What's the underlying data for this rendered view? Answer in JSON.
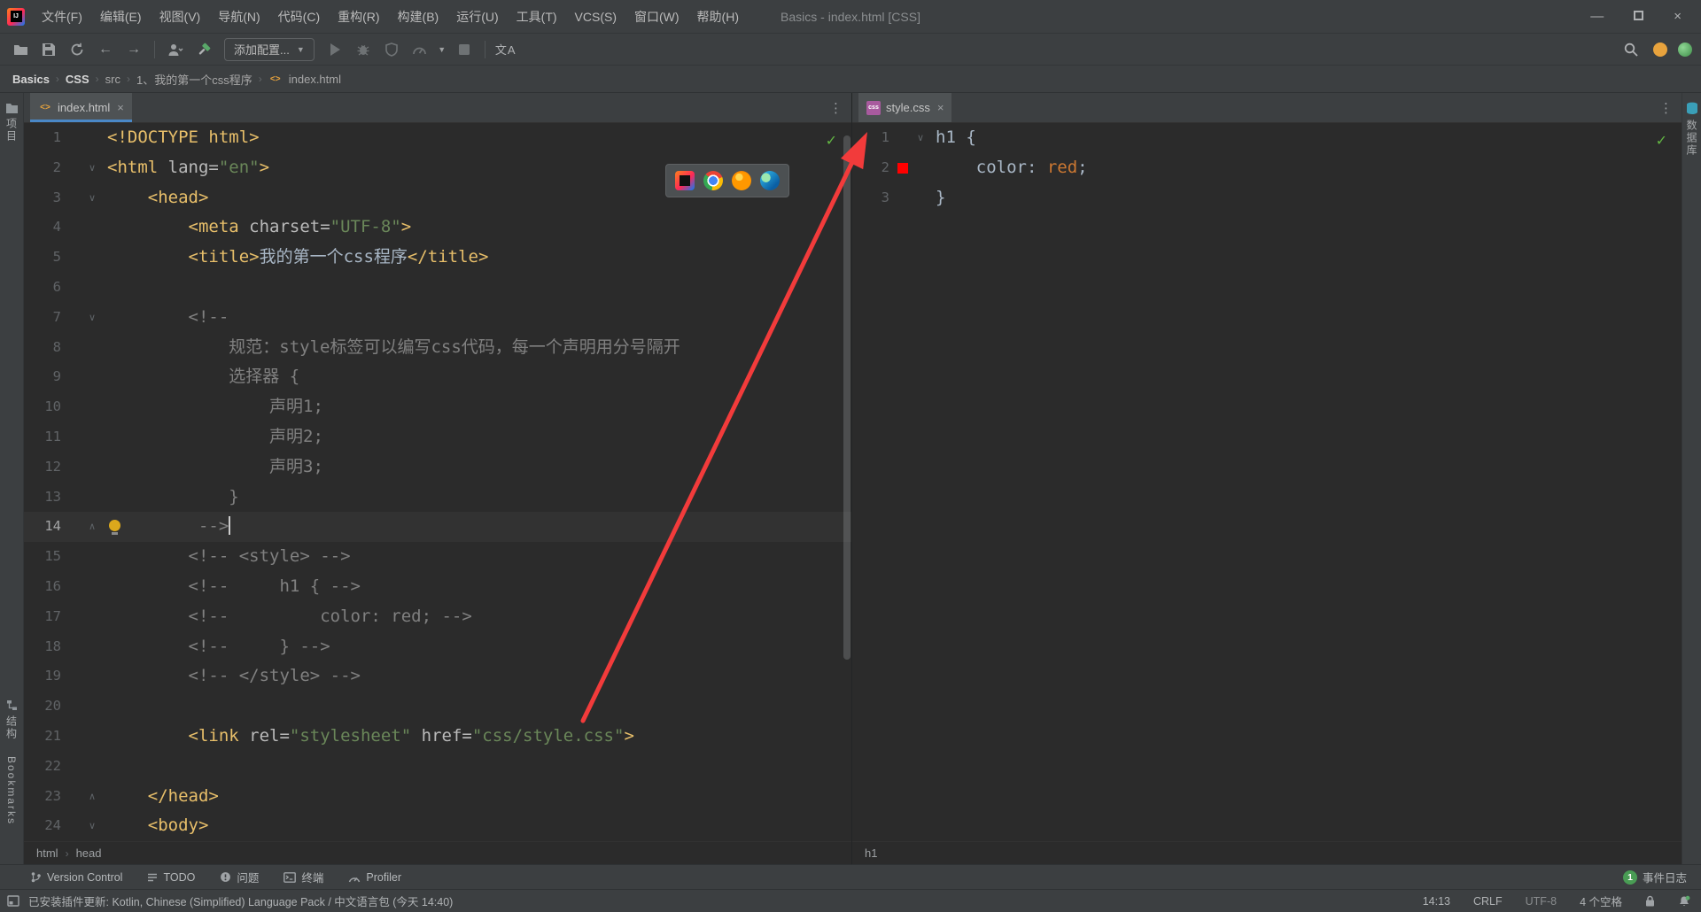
{
  "colors": {
    "annotation_arrow": "#F23B3B",
    "tab_underline": "#4A88C7",
    "event_badge": "#499C54",
    "inspection_ok": "#62B543",
    "css_swatch": "#FF0000"
  },
  "titlebar": {
    "title": "Basics - index.html [CSS]",
    "menus": [
      "文件(F)",
      "编辑(E)",
      "视图(V)",
      "导航(N)",
      "代码(C)",
      "重构(R)",
      "构建(B)",
      "运行(U)",
      "工具(T)",
      "VCS(S)",
      "窗口(W)",
      "帮助(H)"
    ]
  },
  "toolbar": {
    "add_config": "添加配置...",
    "translate": "文A"
  },
  "breadcrumbs": [
    "Basics",
    "CSS",
    "src",
    "1、我的第一个css程序",
    "index.html"
  ],
  "icons": {
    "html_glyph": "<>",
    "css_glyph": "css",
    "check": "✓",
    "more": "⋮",
    "close": "×",
    "back": "←",
    "forward": "→",
    "play": "▶",
    "stop": "■",
    "sep": "›"
  },
  "stripes": {
    "left_top": "项目",
    "left_bottom": [
      "结构",
      "Bookmarks"
    ],
    "right_top": "数据库"
  },
  "panes": {
    "left": {
      "tab": "index.html",
      "crumbs": [
        "html",
        "head"
      ]
    },
    "right": {
      "tab": "style.css",
      "crumbs": [
        "h1"
      ]
    }
  },
  "editor_left_lines": [
    {
      "n": 1,
      "t": [
        [
          "tag",
          "<!DOCTYPE html>"
        ]
      ]
    },
    {
      "n": 2,
      "fold": "v",
      "t": [
        [
          "tag",
          "<html "
        ],
        [
          "attr",
          "lang="
        ],
        [
          "str",
          "\"en\""
        ],
        [
          "tag",
          ">"
        ]
      ]
    },
    {
      "n": 3,
      "fold": "v",
      "t": [
        [
          "tag",
          "    <head>"
        ]
      ]
    },
    {
      "n": 4,
      "t": [
        [
          "tag",
          "        <meta "
        ],
        [
          "attr",
          "charset="
        ],
        [
          "str",
          "\"UTF-8\""
        ],
        [
          "tag",
          ">"
        ]
      ]
    },
    {
      "n": 5,
      "t": [
        [
          "tag",
          "        <title>"
        ],
        [
          "txt",
          "我的第一个css程序"
        ],
        [
          "tag",
          "</title>"
        ]
      ]
    },
    {
      "n": 6,
      "t": []
    },
    {
      "n": 7,
      "fold": "v",
      "t": [
        [
          "cmt",
          "        <!--"
        ]
      ]
    },
    {
      "n": 8,
      "t": [
        [
          "cmt",
          "            规范：style标签可以编写css代码，每一个声明用分号隔开"
        ]
      ]
    },
    {
      "n": 9,
      "t": [
        [
          "cmt",
          "            选择器 {"
        ]
      ]
    },
    {
      "n": 10,
      "t": [
        [
          "cmt",
          "                声明1;"
        ]
      ]
    },
    {
      "n": 11,
      "t": [
        [
          "cmt",
          "                声明2;"
        ]
      ]
    },
    {
      "n": 12,
      "t": [
        [
          "cmt",
          "                声明3;"
        ]
      ]
    },
    {
      "n": 13,
      "t": [
        [
          "cmt",
          "            }"
        ]
      ]
    },
    {
      "n": 14,
      "fold": "^",
      "current": true,
      "caret": true,
      "bulb": true,
      "t": [
        [
          "cmt",
          "         -->"
        ]
      ]
    },
    {
      "n": 15,
      "t": [
        [
          "cmt",
          "        <!-- <style> -->"
        ]
      ]
    },
    {
      "n": 16,
      "t": [
        [
          "cmt",
          "        <!--     h1 { -->"
        ]
      ]
    },
    {
      "n": 17,
      "t": [
        [
          "cmt",
          "        <!--         color: red; -->"
        ]
      ]
    },
    {
      "n": 18,
      "t": [
        [
          "cmt",
          "        <!--     } -->"
        ]
      ]
    },
    {
      "n": 19,
      "t": [
        [
          "cmt",
          "        <!-- </style> -->"
        ]
      ]
    },
    {
      "n": 20,
      "t": []
    },
    {
      "n": 21,
      "t": [
        [
          "tag",
          "        <link "
        ],
        [
          "attr",
          "rel="
        ],
        [
          "str",
          "\"stylesheet\""
        ],
        [
          "attr",
          " href="
        ],
        [
          "str",
          "\"css/style.css\""
        ],
        [
          "tag",
          ">"
        ]
      ]
    },
    {
      "n": 22,
      "t": []
    },
    {
      "n": 23,
      "fold": "^",
      "t": [
        [
          "tag",
          "    </head>"
        ]
      ]
    },
    {
      "n": 24,
      "fold": "v",
      "t": [
        [
          "tag",
          "    <body>"
        ]
      ]
    }
  ],
  "editor_right_lines": [
    {
      "n": 1,
      "fold": "v",
      "t": [
        [
          "def",
          "h1 {"
        ]
      ]
    },
    {
      "n": 2,
      "swatch": "#FF0000",
      "t": [
        [
          "def",
          "    color: "
        ],
        [
          "val",
          "red"
        ],
        [
          "def",
          ";"
        ]
      ]
    },
    {
      "n": 3,
      "t": [
        [
          "def",
          "}"
        ]
      ]
    }
  ],
  "bottom_bar": {
    "items": [
      "Version Control",
      "TODO",
      "问题",
      "终端",
      "Profiler"
    ],
    "event_log": {
      "badge": "1",
      "label": "事件日志"
    }
  },
  "status_bar": {
    "message": "已安装插件更新: Kotlin, Chinese (Simplified) Language Pack / 中文语言包 (今天 14:40)",
    "position": "14:13",
    "line_ending": "CRLF",
    "encoding": "UTF-8",
    "indent": "4 个空格"
  }
}
